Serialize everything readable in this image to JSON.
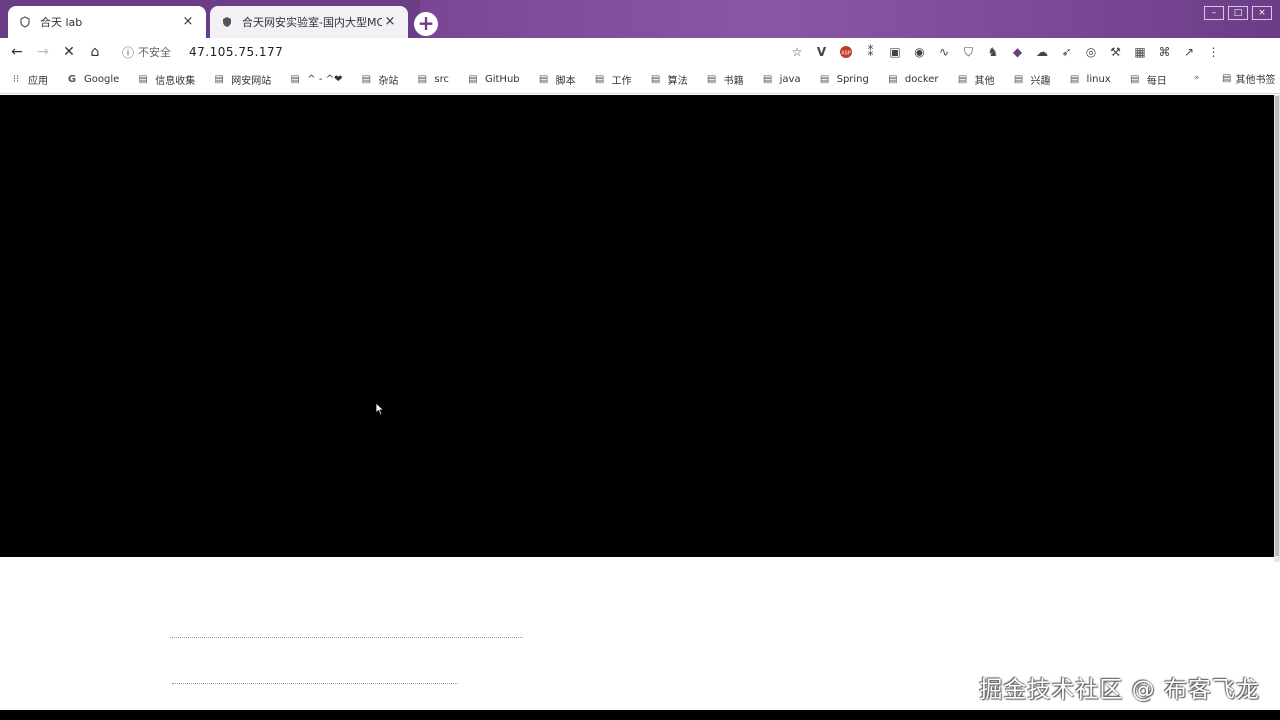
{
  "tabs": [
    {
      "title": "合天 lab",
      "active": true,
      "close": "×"
    },
    {
      "title": "合天网安实验室-国内大型MOOC",
      "active": false,
      "close": "×"
    }
  ],
  "new_tab": "+",
  "toolbar": {
    "back": "←",
    "forward": "→",
    "stop": "✕",
    "home": "⌂",
    "security_icon": "ⓘ",
    "security_label": "不安全",
    "url": "47.105.75.177"
  },
  "bookmarks": [
    {
      "label": "应用",
      "icon": "apps-icon"
    },
    {
      "label": "Google",
      "icon": "google-icon"
    },
    {
      "label": "信息收集",
      "icon": "folder-icon"
    },
    {
      "label": "网安网站",
      "icon": "folder-icon"
    },
    {
      "label": "^ - ^❤",
      "icon": "folder-icon"
    },
    {
      "label": "杂站",
      "icon": "folder-icon"
    },
    {
      "label": "src",
      "icon": "folder-icon"
    },
    {
      "label": "GitHub",
      "icon": "folder-icon"
    },
    {
      "label": "脚本",
      "icon": "folder-icon"
    },
    {
      "label": "工作",
      "icon": "folder-icon"
    },
    {
      "label": "算法",
      "icon": "folder-icon"
    },
    {
      "label": "书籍",
      "icon": "folder-icon"
    },
    {
      "label": "java",
      "icon": "folder-icon"
    },
    {
      "label": "Spring",
      "icon": "folder-icon"
    },
    {
      "label": "docker",
      "icon": "folder-icon"
    },
    {
      "label": "其他",
      "icon": "folder-icon"
    },
    {
      "label": "兴趣",
      "icon": "folder-icon"
    },
    {
      "label": "linux",
      "icon": "folder-icon"
    },
    {
      "label": "每日",
      "icon": "folder-icon"
    }
  ],
  "bookmarks_more": "»",
  "other_bookmarks": "其他书签",
  "watermark": "掘金技术社区 @ 布客飞龙",
  "colors": {
    "tabstrip": "#6b3d87",
    "content": "#000000"
  }
}
